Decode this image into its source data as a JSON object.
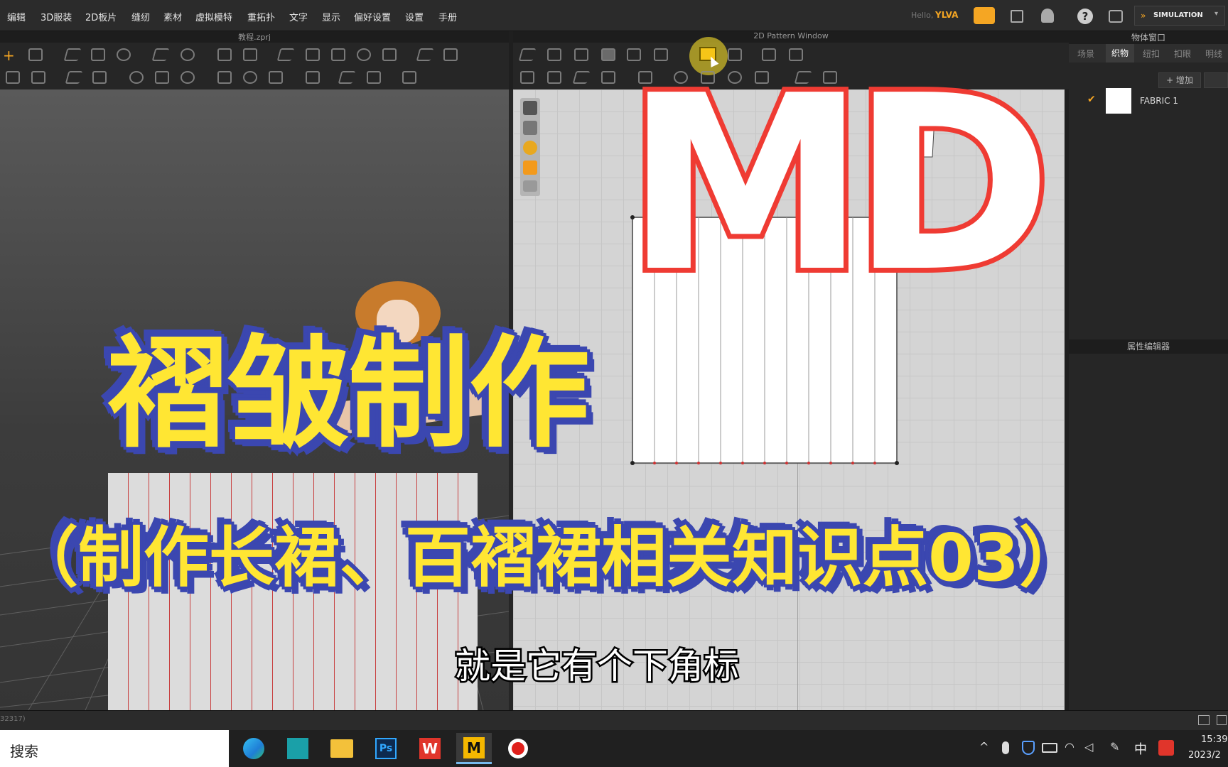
{
  "menu": [
    "编辑",
    "3D服装",
    "2D板片",
    "缝纫",
    "素材",
    "虚拟模特",
    "重拓扑",
    "文字",
    "显示",
    "偏好设置",
    "设置",
    "手册"
  ],
  "user": {
    "greeting": "Hello,",
    "name": "YLVA"
  },
  "mode": {
    "label": "SIMULATION"
  },
  "windows": {
    "view3d_title": "教程.zprj",
    "view2d_title": "2D Pattern Window",
    "object_title": "物体窗口",
    "property_title": "属性编辑器"
  },
  "object_tabs": [
    "场景",
    "织物",
    "纽扣",
    "扣眼",
    "明线"
  ],
  "object_active_tab": "织物",
  "add_button": "+ 增加",
  "fabric": {
    "name": "FABRIC 1"
  },
  "overlay": {
    "logo": "MD",
    "title": "褶皱制作",
    "subtitle": "（制作长裙、百褶裙相关知识点03）",
    "caption": "就是它有个下角标"
  },
  "status": {
    "left": "32317)"
  },
  "taskbar": {
    "search": "搜索",
    "time": "15:39",
    "date": "2023/2",
    "ime": "中"
  },
  "colors": {
    "accent": "#f5a623",
    "logo_red": "#ef3b33",
    "title_yellow": "#ffe633",
    "title_blue": "#3b47b0"
  }
}
